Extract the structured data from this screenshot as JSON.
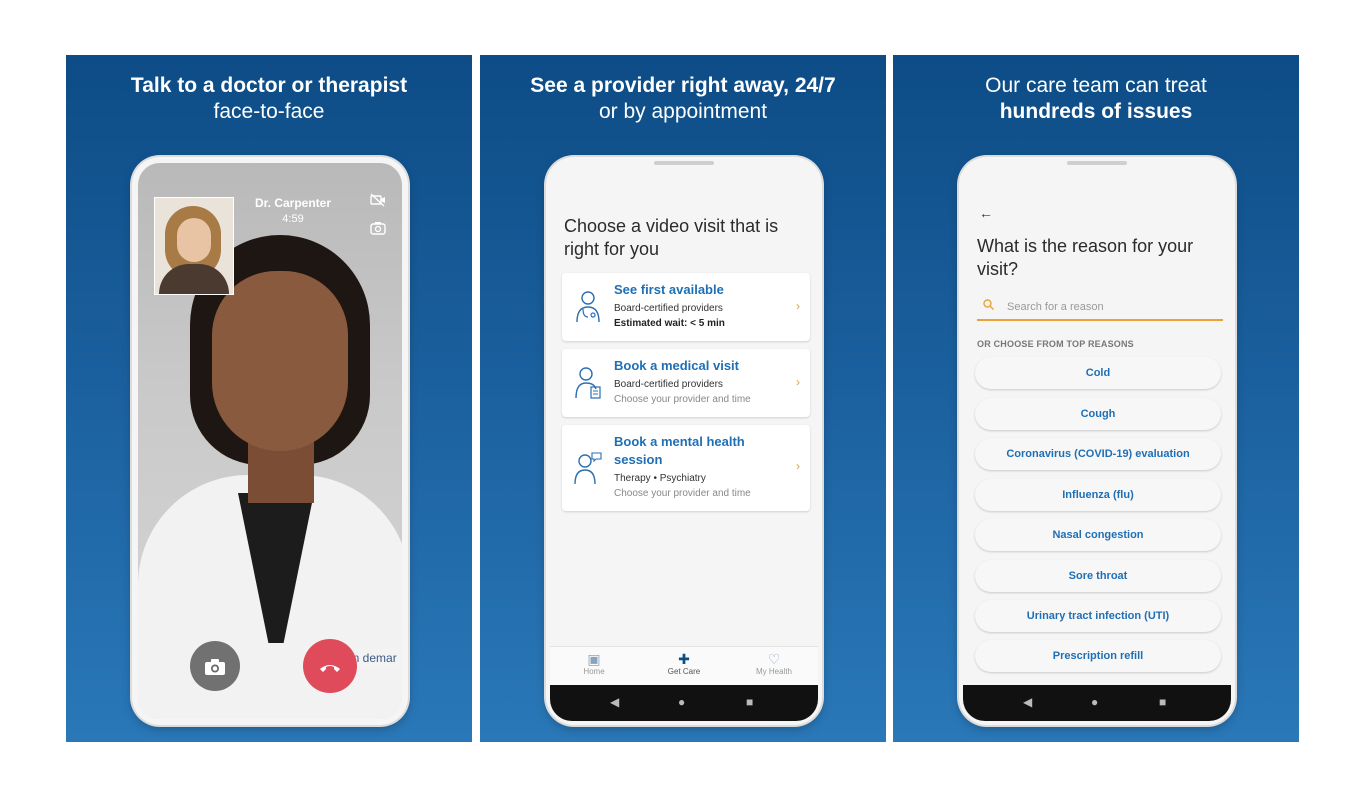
{
  "panel1": {
    "headline_bold": "Talk to a doctor or therapist",
    "headline_light": "face-to-face",
    "doctor_name": "Dr. Carpenter",
    "call_time": "4:59",
    "brand_text": "on demar"
  },
  "panel2": {
    "headline_bold": "See a provider right away, 24/7",
    "headline_light": "or by appointment",
    "title": "Choose a video visit that is right for you",
    "cards": [
      {
        "title": "See first available",
        "line1": "Board-certified providers",
        "line2": "Estimated wait: < 5 min"
      },
      {
        "title": "Book a medical visit",
        "line1": "Board-certified providers",
        "line2": "Choose your provider and time"
      },
      {
        "title": "Book a mental health session",
        "line1": "Therapy • Psychiatry",
        "line2": "Choose your provider and time"
      }
    ],
    "tabs": [
      {
        "label": "Home"
      },
      {
        "label": "Get Care"
      },
      {
        "label": "My Health"
      }
    ]
  },
  "panel3": {
    "headline_light": "Our care team can treat",
    "headline_bold": "hundreds of issues",
    "title": "What is the reason for your visit?",
    "search_placeholder": "Search for a reason",
    "section_label": "OR CHOOSE FROM TOP REASONS",
    "reasons": [
      "Cold",
      "Cough",
      "Coronavirus (COVID-19) evaluation",
      "Influenza (flu)",
      "Nasal congestion",
      "Sore throat",
      "Urinary tract infection (UTI)",
      "Prescription refill"
    ]
  },
  "colors": {
    "panel_bg": "#1a5f9d",
    "accent_blue": "#1f6fb5",
    "accent_orange": "#e8a33a",
    "end_call_red": "#e04b5b"
  }
}
